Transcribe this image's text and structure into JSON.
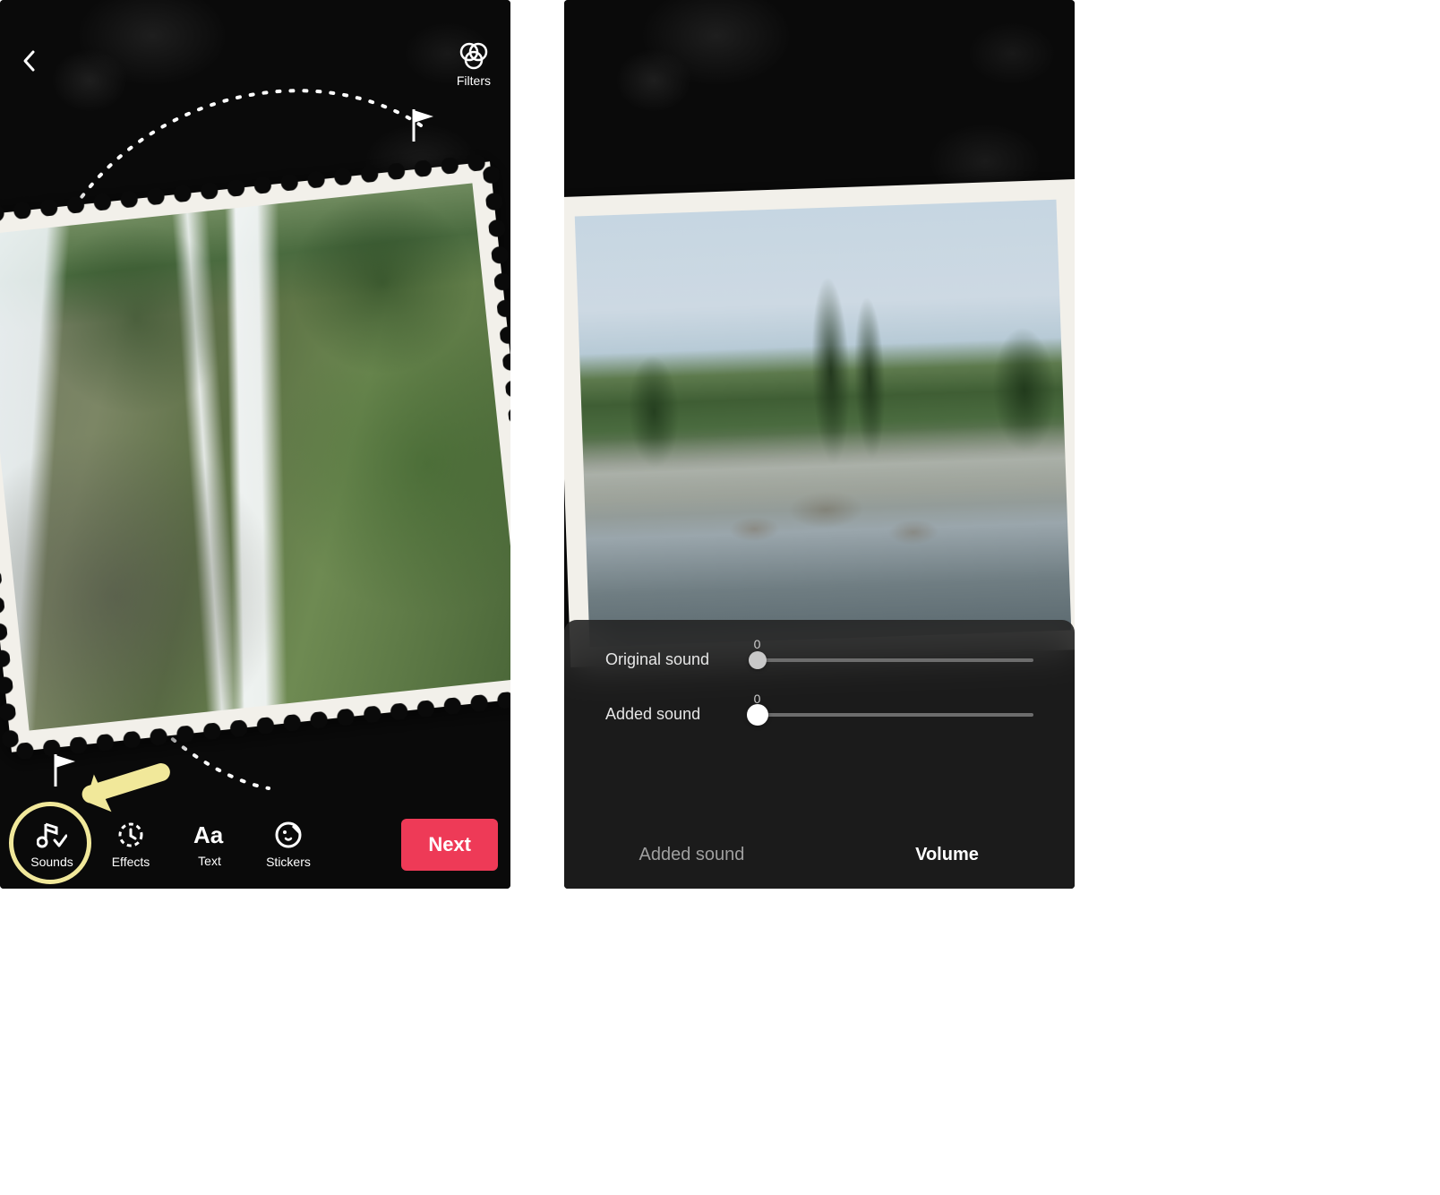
{
  "screen1": {
    "header": {
      "filters_label": "Filters"
    },
    "toolbar": {
      "sounds_label": "Sounds",
      "effects_label": "Effects",
      "text_label": "Text",
      "stickers_label": "Stickers",
      "next_label": "Next"
    }
  },
  "screen2": {
    "volume_panel": {
      "original_label": "Original sound",
      "original_value": "0",
      "added_label": "Added sound",
      "added_value": "0",
      "tab_added_sound": "Added sound",
      "tab_volume": "Volume"
    }
  },
  "colors": {
    "accent": "#ee3a57",
    "highlight": "#f1e89a"
  }
}
